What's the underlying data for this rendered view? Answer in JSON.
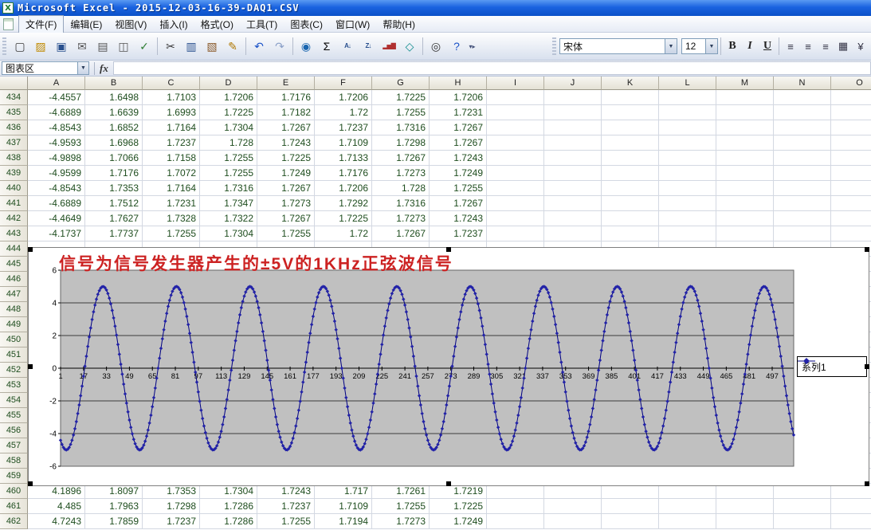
{
  "window": {
    "title": "Microsoft Excel - 2015-12-03-16-39-DAQ1.CSV"
  },
  "menubar": {
    "items": [
      {
        "id": "file",
        "label": "文件(F)"
      },
      {
        "id": "edit",
        "label": "编辑(E)"
      },
      {
        "id": "view",
        "label": "视图(V)"
      },
      {
        "id": "insert",
        "label": "插入(I)"
      },
      {
        "id": "format",
        "label": "格式(O)"
      },
      {
        "id": "tools",
        "label": "工具(T)"
      },
      {
        "id": "chart",
        "label": "图表(C)"
      },
      {
        "id": "window",
        "label": "窗口(W)"
      },
      {
        "id": "help",
        "label": "帮助(H)"
      }
    ]
  },
  "toolbar": {
    "icon_groups": [
      [
        {
          "name": "new-workbook",
          "glyph": "▢",
          "color": "#3a3a3a"
        },
        {
          "name": "open",
          "glyph": "▨",
          "color": "#c08a00"
        },
        {
          "name": "save",
          "glyph": "▣",
          "color": "#29508e"
        },
        {
          "name": "email",
          "glyph": "✉",
          "color": "#555555"
        },
        {
          "name": "print",
          "glyph": "▤",
          "color": "#555555"
        },
        {
          "name": "print-preview",
          "glyph": "◫",
          "color": "#555555"
        },
        {
          "name": "spelling",
          "glyph": "✓",
          "color": "#2e7d32"
        }
      ],
      [
        {
          "name": "cut",
          "glyph": "✂",
          "color": "#333333"
        },
        {
          "name": "copy",
          "glyph": "▥",
          "color": "#29508e"
        },
        {
          "name": "paste",
          "glyph": "▧",
          "color": "#8a5a2a"
        },
        {
          "name": "format-painter",
          "glyph": "✎",
          "color": "#b07800"
        }
      ],
      [
        {
          "name": "undo",
          "glyph": "↶",
          "color": "#1a52c8"
        },
        {
          "name": "redo",
          "glyph": "↷",
          "color": "#8aa0c8"
        }
      ],
      [
        {
          "name": "insert-hyperlink",
          "glyph": "◉",
          "color": "#1a66b0"
        },
        {
          "name": "autosum",
          "glyph": "Σ",
          "color": "#000000"
        },
        {
          "name": "sort-ascending",
          "glyph": "A↓",
          "color": "#29508e",
          "small": true
        },
        {
          "name": "sort-descending",
          "glyph": "Z↓",
          "color": "#29508e",
          "small": true
        },
        {
          "name": "chart-wizard",
          "glyph": "▂▅▇",
          "color": "#b03030",
          "small": true
        },
        {
          "name": "drawing",
          "glyph": "◇",
          "color": "#0a8a8a"
        }
      ],
      [
        {
          "name": "zoom",
          "glyph": "◎",
          "color": "#333333"
        },
        {
          "name": "help",
          "glyph": "?",
          "color": "#1a52c8"
        }
      ]
    ],
    "formatting": {
      "font_name": "宋体",
      "font_size": "12",
      "style_buttons": [
        {
          "name": "bold",
          "glyph": "B"
        },
        {
          "name": "italic",
          "glyph": "I"
        },
        {
          "name": "underline",
          "glyph": "U"
        }
      ],
      "align_buttons": [
        {
          "name": "align-left",
          "glyph": "≡"
        },
        {
          "name": "align-center",
          "glyph": "≡"
        },
        {
          "name": "align-right",
          "glyph": "≡"
        },
        {
          "name": "merge-and-center",
          "glyph": "▦"
        },
        {
          "name": "currency-style",
          "glyph": "¥"
        }
      ]
    }
  },
  "formula_bar": {
    "name_box": "图表区",
    "fx_label": "fx",
    "formula": ""
  },
  "grid": {
    "columns": [
      "A",
      "B",
      "C",
      "D",
      "E",
      "F",
      "G",
      "H",
      "I",
      "J",
      "K",
      "L",
      "M",
      "N",
      "O"
    ],
    "rows": [
      {
        "n": "434",
        "c": [
          "-4.4557",
          "1.6498",
          "1.7103",
          "1.7206",
          "1.7176",
          "1.7206",
          "1.7225",
          "1.7206"
        ]
      },
      {
        "n": "435",
        "c": [
          "-4.6889",
          "1.6639",
          "1.6993",
          "1.7225",
          "1.7182",
          "1.72",
          "1.7255",
          "1.7231"
        ]
      },
      {
        "n": "436",
        "c": [
          "-4.8543",
          "1.6852",
          "1.7164",
          "1.7304",
          "1.7267",
          "1.7237",
          "1.7316",
          "1.7267"
        ]
      },
      {
        "n": "437",
        "c": [
          "-4.9593",
          "1.6968",
          "1.7237",
          "1.728",
          "1.7243",
          "1.7109",
          "1.7298",
          "1.7267"
        ]
      },
      {
        "n": "438",
        "c": [
          "-4.9898",
          "1.7066",
          "1.7158",
          "1.7255",
          "1.7225",
          "1.7133",
          "1.7267",
          "1.7243"
        ]
      },
      {
        "n": "439",
        "c": [
          "-4.9599",
          "1.7176",
          "1.7072",
          "1.7255",
          "1.7249",
          "1.7176",
          "1.7273",
          "1.7249"
        ]
      },
      {
        "n": "440",
        "c": [
          "-4.8543",
          "1.7353",
          "1.7164",
          "1.7316",
          "1.7267",
          "1.7206",
          "1.728",
          "1.7255"
        ]
      },
      {
        "n": "441",
        "c": [
          "-4.6889",
          "1.7512",
          "1.7231",
          "1.7347",
          "1.7273",
          "1.7292",
          "1.7316",
          "1.7267"
        ]
      },
      {
        "n": "442",
        "c": [
          "-4.4649",
          "1.7627",
          "1.7328",
          "1.7322",
          "1.7267",
          "1.7225",
          "1.7273",
          "1.7243"
        ]
      },
      {
        "n": "443",
        "c": [
          "-4.1737",
          "1.7737",
          "1.7255",
          "1.7304",
          "1.7255",
          "1.72",
          "1.7267",
          "1.7237"
        ]
      },
      {
        "n": "444",
        "c": []
      },
      {
        "n": "445",
        "c": []
      },
      {
        "n": "446",
        "c": []
      },
      {
        "n": "447",
        "c": []
      },
      {
        "n": "448",
        "c": []
      },
      {
        "n": "449",
        "c": []
      },
      {
        "n": "450",
        "c": []
      },
      {
        "n": "451",
        "c": []
      },
      {
        "n": "452",
        "c": []
      },
      {
        "n": "453",
        "c": []
      },
      {
        "n": "454",
        "c": []
      },
      {
        "n": "455",
        "c": []
      },
      {
        "n": "456",
        "c": []
      },
      {
        "n": "457",
        "c": []
      },
      {
        "n": "458",
        "c": []
      },
      {
        "n": "459",
        "c": []
      },
      {
        "n": "460",
        "c": [
          "4.1896",
          "1.8097",
          "1.7353",
          "1.7304",
          "1.7243",
          "1.717",
          "1.7261",
          "1.7219"
        ]
      },
      {
        "n": "461",
        "c": [
          "4.485",
          "1.7963",
          "1.7298",
          "1.7286",
          "1.7237",
          "1.7109",
          "1.7255",
          "1.7225"
        ]
      },
      {
        "n": "462",
        "c": [
          "4.7243",
          "1.7859",
          "1.7237",
          "1.7286",
          "1.7255",
          "1.7194",
          "1.7273",
          "1.7249"
        ]
      }
    ]
  },
  "chart_data": {
    "type": "line",
    "title": "信号为信号发生器产生的±5V的1KHz正弦波信号",
    "title_color": "#cc2222",
    "plot_bg": "#c0c0c0",
    "legend": [
      "系列1"
    ],
    "legend_position": "right",
    "ylim": [
      -6,
      6
    ],
    "y_ticks": [
      6,
      4,
      2,
      0,
      -2,
      -4,
      -6
    ],
    "y_gridlines": [
      4,
      2,
      -2,
      -4
    ],
    "x_ticks": [
      1,
      17,
      33,
      49,
      65,
      81,
      97,
      113,
      129,
      145,
      161,
      177,
      193,
      209,
      225,
      241,
      257,
      273,
      289,
      305,
      321,
      337,
      353,
      369,
      385,
      401,
      417,
      433,
      449,
      465,
      481,
      497
    ],
    "series": [
      {
        "name": "系列1",
        "color": "#000080",
        "marker_color": "#2222a8",
        "marker": "diamond",
        "points": 512,
        "cycles": 10,
        "amplitude": 5,
        "first_trough_index": 5,
        "description": "±5V 1KHz sine wave, 512 samples, y(i) = -5*cos(2*pi*(i-5)/51.2)"
      }
    ]
  }
}
